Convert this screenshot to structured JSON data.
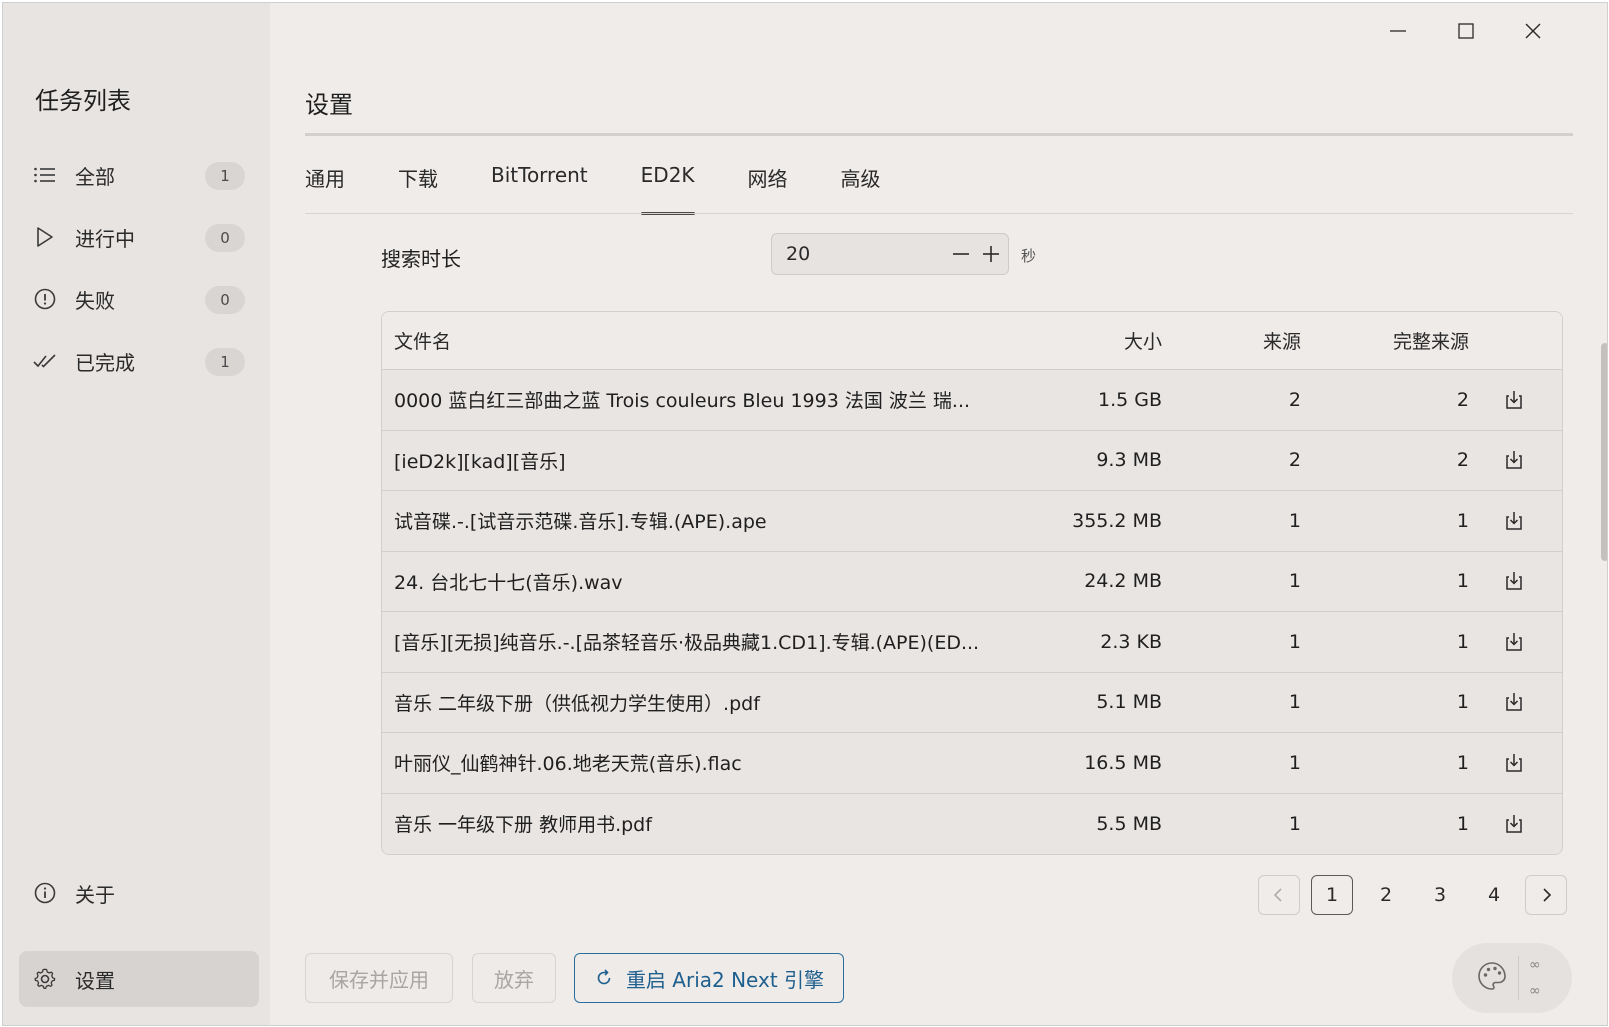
{
  "window": {
    "controls": [
      "minimize",
      "maximize",
      "close"
    ]
  },
  "sidebar": {
    "title": "任务列表",
    "items": [
      {
        "label": "全部",
        "count": "1",
        "icon": "list-icon"
      },
      {
        "label": "进行中",
        "count": "0",
        "icon": "play-icon"
      },
      {
        "label": "失败",
        "count": "0",
        "icon": "alert-circle-icon"
      },
      {
        "label": "已完成",
        "count": "1",
        "icon": "double-check-icon"
      }
    ],
    "footer": [
      {
        "label": "关于",
        "icon": "info-icon"
      },
      {
        "label": "设置",
        "icon": "gear-icon",
        "active": true
      }
    ]
  },
  "main": {
    "title": "设置",
    "tabs": [
      {
        "label": "通用"
      },
      {
        "label": "下载"
      },
      {
        "label": "BitTorrent"
      },
      {
        "label": "ED2K",
        "active": true
      },
      {
        "label": "网络"
      },
      {
        "label": "高级"
      }
    ],
    "search_duration": {
      "label": "搜索时长",
      "value": "20",
      "unit": "秒"
    },
    "table": {
      "headers": {
        "name": "文件名",
        "size": "大小",
        "sources": "来源",
        "complete_sources": "完整来源"
      },
      "rows": [
        {
          "name": "0000 蓝白红三部曲之蓝 Trois couleurs Bleu 1993 法国 波兰 瑞...",
          "size": "1.5 GB",
          "sources": "2",
          "complete": "2"
        },
        {
          "name": "[ieD2k][kad][音乐]",
          "size": "9.3 MB",
          "sources": "2",
          "complete": "2"
        },
        {
          "name": "试音碟.-.[试音示范碟.音乐].专辑.(APE).ape",
          "size": "355.2 MB",
          "sources": "1",
          "complete": "1"
        },
        {
          "name": "24. 台北七十七(音乐).wav",
          "size": "24.2 MB",
          "sources": "1",
          "complete": "1"
        },
        {
          "name": "[音乐][无损]纯音乐.-.[品茶轻音乐·极品典藏1.CD1].专辑.(APE)(ED...",
          "size": "2.3 KB",
          "sources": "1",
          "complete": "1"
        },
        {
          "name": "音乐 二年级下册（供低视力学生使用）.pdf",
          "size": "5.1 MB",
          "sources": "1",
          "complete": "1"
        },
        {
          "name": "叶丽仪_仙鹤神针.06.地老天荒(音乐).flac",
          "size": "16.5 MB",
          "sources": "1",
          "complete": "1"
        },
        {
          "name": "音乐 一年级下册 教师用书.pdf",
          "size": "5.5 MB",
          "sources": "1",
          "complete": "1"
        }
      ]
    },
    "pagination": {
      "pages": [
        "1",
        "2",
        "3",
        "4"
      ],
      "current": "1"
    },
    "buttons": {
      "save": "保存并应用",
      "discard": "放弃",
      "restart": "重启 Aria2 Next 引擎"
    },
    "speed_widget": {
      "upload": "∞",
      "download": "∞",
      "icon": "palette-icon"
    }
  },
  "colors": {
    "accent": "#1e5f8e",
    "sidebar_bg": "#e8e4e2",
    "content_bg": "#f0ecea"
  }
}
